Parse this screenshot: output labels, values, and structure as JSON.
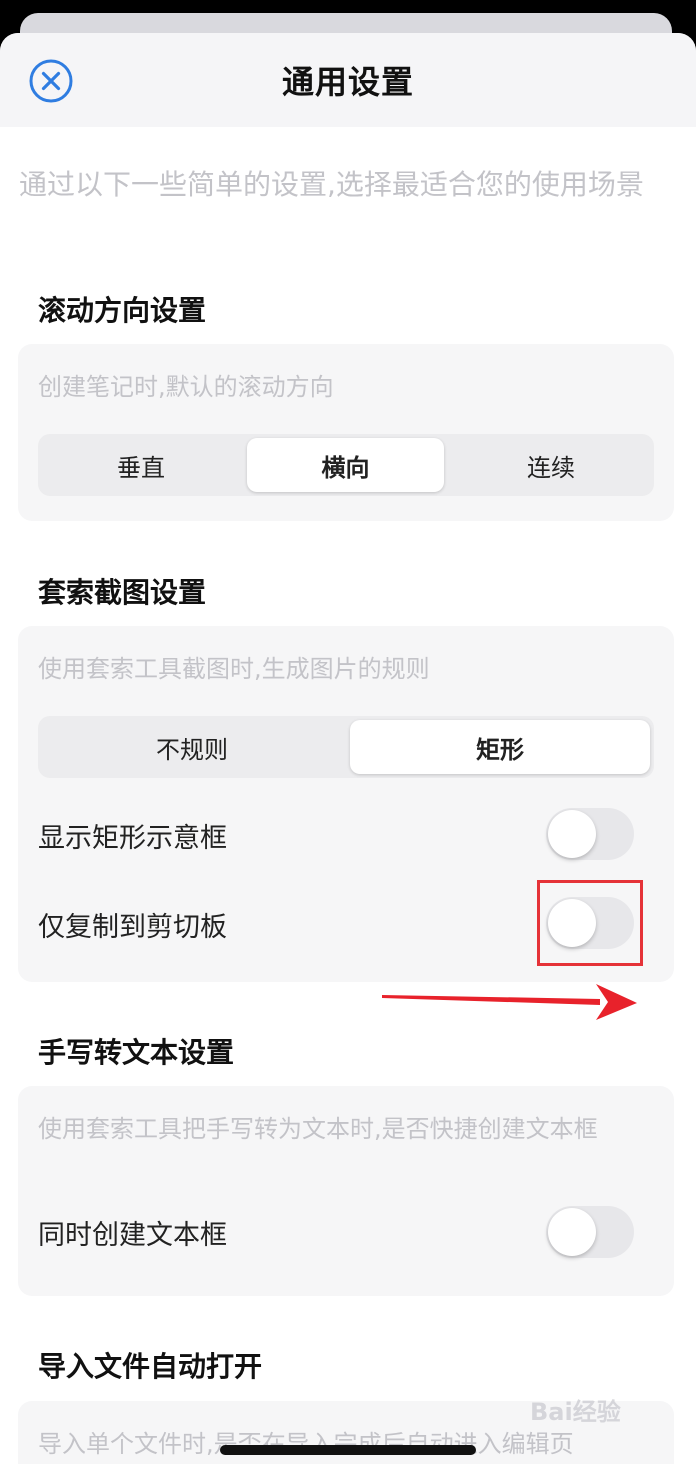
{
  "header": {
    "title": "通用设置",
    "close_icon": "close-circle-icon"
  },
  "intro_text": "通过以下一些简单的设置,选择最适合您的使用场景",
  "scroll_section": {
    "title": "滚动方向设置",
    "description": "创建笔记时,默认的滚动方向",
    "options": [
      "垂直",
      "横向",
      "连续"
    ],
    "selected": "横向"
  },
  "lasso_section": {
    "title": "套索截图设置",
    "description": "使用套索工具截图时,生成图片的规则",
    "options": [
      "不规则",
      "矩形"
    ],
    "selected": "矩形",
    "toggles": [
      {
        "label": "显示矩形示意框",
        "on": false
      },
      {
        "label": "仅复制到剪切板",
        "on": false
      }
    ]
  },
  "handwriting_section": {
    "title": "手写转文本设置",
    "description": "使用套索工具把手写转为文本时,是否快捷创建文本框",
    "toggles": [
      {
        "label": "同时创建文本框",
        "on": false
      }
    ]
  },
  "import_section": {
    "title": "导入文件自动打开",
    "description": "导入单个文件时,是否在导入完成后自动进入编辑页"
  },
  "annotation": {
    "highlight_color": "#e53238",
    "arrow_color": "#e8222b"
  },
  "watermark": "Bai经验"
}
